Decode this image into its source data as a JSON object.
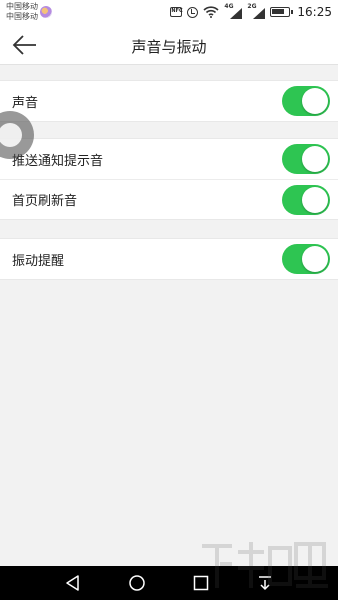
{
  "status_bar": {
    "carrier_1": "中国移动",
    "carrier_2": "中国移动",
    "nfc": "NFC",
    "sim1_network": "4G",
    "sim2_network": "2G",
    "time": "16:25"
  },
  "header": {
    "title": "声音与振动"
  },
  "sections": [
    {
      "rows": [
        {
          "label": "声音",
          "enabled": true
        }
      ]
    },
    {
      "rows": [
        {
          "label": "推送通知提示音",
          "enabled": true
        },
        {
          "label": "首页刷新音",
          "enabled": true
        }
      ]
    },
    {
      "rows": [
        {
          "label": "振动提醒",
          "enabled": true
        }
      ]
    }
  ],
  "colors": {
    "toggle_on": "#2ec552",
    "page_background": "#f2f2f2",
    "navbar": "#000000"
  },
  "icons": {
    "back": "arrow-left-icon",
    "nav_back": "triangle-back-icon",
    "nav_home": "circle-home-icon",
    "nav_recents": "square-recents-icon",
    "nav_notification": "pull-down-icon"
  }
}
